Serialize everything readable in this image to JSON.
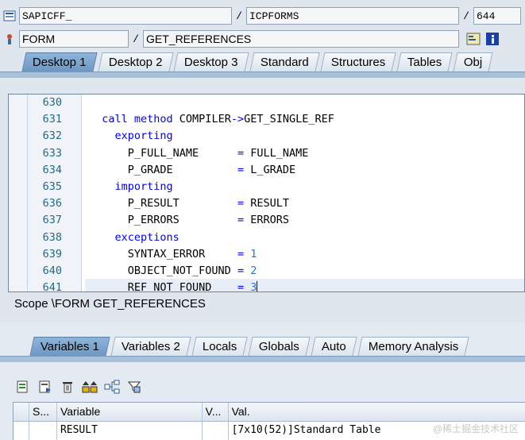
{
  "header": {
    "row1": {
      "program": "SAPICFF_",
      "include": "ICPFORMS",
      "line": "644"
    },
    "row2": {
      "scope_type": "FORM",
      "scope_name": "GET_REFERENCES"
    }
  },
  "top_tabs": [
    "Desktop 1",
    "Desktop 2",
    "Desktop 3",
    "Standard",
    "Structures",
    "Tables",
    "Obj"
  ],
  "top_tabs_active": 0,
  "editor": {
    "lines": [
      {
        "n": "630",
        "parts": []
      },
      {
        "n": "631",
        "parts": [
          [
            "  ",
            ""
          ],
          [
            "call method",
            "kw"
          ],
          [
            " COMPILER",
            ""
          ],
          [
            "->",
            "op"
          ],
          [
            "GET_SINGLE_REF",
            ""
          ]
        ]
      },
      {
        "n": "632",
        "parts": [
          [
            "    ",
            ""
          ],
          [
            "exporting",
            "kw"
          ]
        ]
      },
      {
        "n": "633",
        "parts": [
          [
            "      P_FULL_NAME      ",
            ""
          ],
          [
            "=",
            "op"
          ],
          [
            " FULL_NAME",
            ""
          ]
        ]
      },
      {
        "n": "634",
        "parts": [
          [
            "      P_GRADE          ",
            ""
          ],
          [
            "=",
            "op"
          ],
          [
            " L_GRADE",
            ""
          ]
        ]
      },
      {
        "n": "635",
        "parts": [
          [
            "    ",
            ""
          ],
          [
            "importing",
            "kw"
          ]
        ]
      },
      {
        "n": "636",
        "parts": [
          [
            "      P_RESULT         ",
            ""
          ],
          [
            "=",
            "op"
          ],
          [
            " RESULT",
            ""
          ]
        ]
      },
      {
        "n": "637",
        "parts": [
          [
            "      P_ERRORS         ",
            ""
          ],
          [
            "=",
            "op"
          ],
          [
            " ERRORS",
            ""
          ]
        ]
      },
      {
        "n": "638",
        "parts": [
          [
            "    ",
            ""
          ],
          [
            "exceptions",
            "kw"
          ]
        ]
      },
      {
        "n": "639",
        "parts": [
          [
            "      SYNTAX_ERROR     ",
            ""
          ],
          [
            "=",
            "op"
          ],
          [
            " ",
            ""
          ],
          [
            "1",
            "num"
          ]
        ]
      },
      {
        "n": "640",
        "parts": [
          [
            "      OBJECT_NOT_FOUND ",
            ""
          ],
          [
            "=",
            "op"
          ],
          [
            " ",
            ""
          ],
          [
            "2",
            "num"
          ]
        ]
      },
      {
        "n": "641",
        "parts": [
          [
            "      REF_NOT_FOUND    ",
            ""
          ],
          [
            "=",
            "op"
          ],
          [
            " ",
            ""
          ],
          [
            "3",
            "num"
          ]
        ]
      }
    ]
  },
  "scope_text": "Scope \\FORM GET_REFERENCES",
  "bottom_tabs": [
    "Variables 1",
    "Variables 2",
    "Locals",
    "Globals",
    "Auto",
    "Memory Analysis"
  ],
  "bottom_tabs_active": 0,
  "toolbar_icons": [
    "grid-detail-icon",
    "grid-export-icon",
    "delete-icon",
    "sort-icon",
    "tree-icon",
    "filter-icon"
  ],
  "table": {
    "headers": [
      "S...",
      "Variable",
      "V...",
      "Val."
    ],
    "rows": [
      {
        "s": "",
        "variable": "RESULT",
        "v": "",
        "value": "[7x10(52)]Standard Table"
      }
    ]
  },
  "watermark": "@稀土掘金技术社区"
}
